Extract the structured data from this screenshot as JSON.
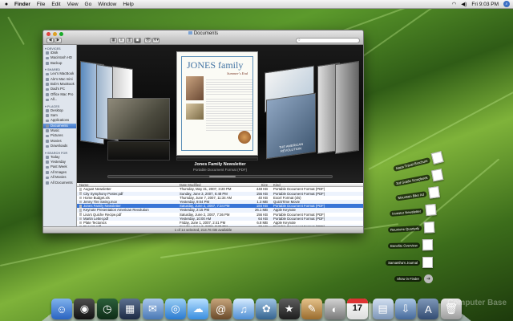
{
  "menubar": {
    "apple": "",
    "items": [
      "Finder",
      "File",
      "Edit",
      "View",
      "Go",
      "Window",
      "Help"
    ],
    "clock": "Fri 9:03 PM"
  },
  "window": {
    "title": "Documents",
    "search_placeholder": ""
  },
  "sidebar": {
    "sections": [
      {
        "head": "▾ DEVICES",
        "items": [
          "iDisk",
          "Macintosh HD",
          "Backup"
        ]
      },
      {
        "head": "▾ SHARED",
        "items": [
          "Leo's MacBook",
          "Ale's Mac mini",
          "Bob's MacBook",
          "Dad's PC",
          "Office Mac Pro",
          "All..."
        ]
      },
      {
        "head": "▾ PLACES",
        "items": [
          "Desktop",
          "Sam",
          "Applications",
          "Documents",
          "Music",
          "Pictures",
          "Movies",
          "Downloads"
        ]
      },
      {
        "head": "▾ SEARCH FOR",
        "items": [
          "Today",
          "Yesterday",
          "Past Week",
          "All Images",
          "All Movies",
          "All Documents"
        ]
      }
    ],
    "selected": "Documents"
  },
  "coverflow": {
    "doc_title": "JONES family",
    "doc_heading": "Summer's End",
    "selected_title": "Jones Family Newsletter",
    "selected_kind": "Portable Document Format (PDF)",
    "right_card_text": "THE AMERICAN REVOLUTION"
  },
  "list": {
    "headers": [
      "Name",
      "Date Modified",
      "Size",
      "Kind"
    ],
    "rows": [
      [
        "August Newsletter",
        "Thursday, May 31, 2007, 3:20 PM",
        "448 KB",
        "Portable Document Format (PDF)"
      ],
      [
        "City Symphony Poster.pdf",
        "Sunday, June 3, 2007, 6:48 PM",
        "156 KB",
        "Portable Document Format (PDF)"
      ],
      [
        "Home Budget.xls",
        "Thursday, June 7, 2007, 11:34 AM",
        "40 KB",
        "Excel Format (xls)"
      ],
      [
        "Jenny Tire Swing.mov",
        "Yesterday, 9:04 PM",
        "1.3 MB",
        "QuickTime Movie"
      ],
      [
        "Jones Family Newsletter",
        "Saturday, June 2, 2007, 7:34 PM",
        "184 KB",
        "Portable Document Format (PDF)"
      ],
      [
        "Keynote Presentation American Revolution",
        "Yesterday, 2:15 PM",
        "26.1 MB",
        "Apple Keynote"
      ],
      [
        "Lisa's Quiche Recipe.pdf",
        "Saturday, June 2, 2007, 7:36 PM",
        "156 KB",
        "Portable Document Format (PDF)"
      ],
      [
        "Martin Letter.pdf",
        "Yesterday, 10:00 AM",
        "64 KB",
        "Portable Document Format (PDF)"
      ],
      [
        "Plate Tectonics",
        "Friday, June 1, 2007, 2:41 PM",
        "6.8 MB",
        "Apple Keynote"
      ],
      [
        "Receipt.pdf",
        "Sunday, June 3, 2007, 7:38 PM",
        "72 KB",
        "Portable Document Format (PDF)"
      ],
      [
        "Syllabus",
        "Wednesday, May 30, 2007, 8:17 PM",
        "36 KB",
        "Word 97 Format (doc)"
      ],
      [
        "Tree Conservation.pdf",
        "Saturday, June 2, 2007, 7:36 PM",
        "56 KB",
        "Portable Document Format (PDF)"
      ],
      [
        "Weather Project.xls",
        "Friday, June 1, 2007, 2:39 PM",
        "108 KB",
        "Excel Format (xls)"
      ]
    ],
    "selected_index": 4,
    "status": "1 of 14 selected, 213.76 GB available"
  },
  "stack": {
    "items": [
      "Napa Travel Brochure",
      "3rd Grade Scrapbook",
      "Mountain Bike Ad",
      "Investor Newsletter",
      "Reunions Quarterly",
      "Benefits Overview",
      "Samantha's Journal",
      "Show in Finder"
    ]
  },
  "dock": {
    "items": [
      "Finder",
      "Dashboard",
      "Time Machine",
      "Spaces",
      "Mail",
      "Safari",
      "iChat",
      "Address Book",
      "iTunes",
      "iPhoto",
      "iMovie",
      "iWeb",
      "Preview",
      "iCal",
      "Documents",
      "Downloads",
      "Applications",
      "Trash"
    ],
    "ical_date": "17"
  },
  "watermark": "Computer Base"
}
